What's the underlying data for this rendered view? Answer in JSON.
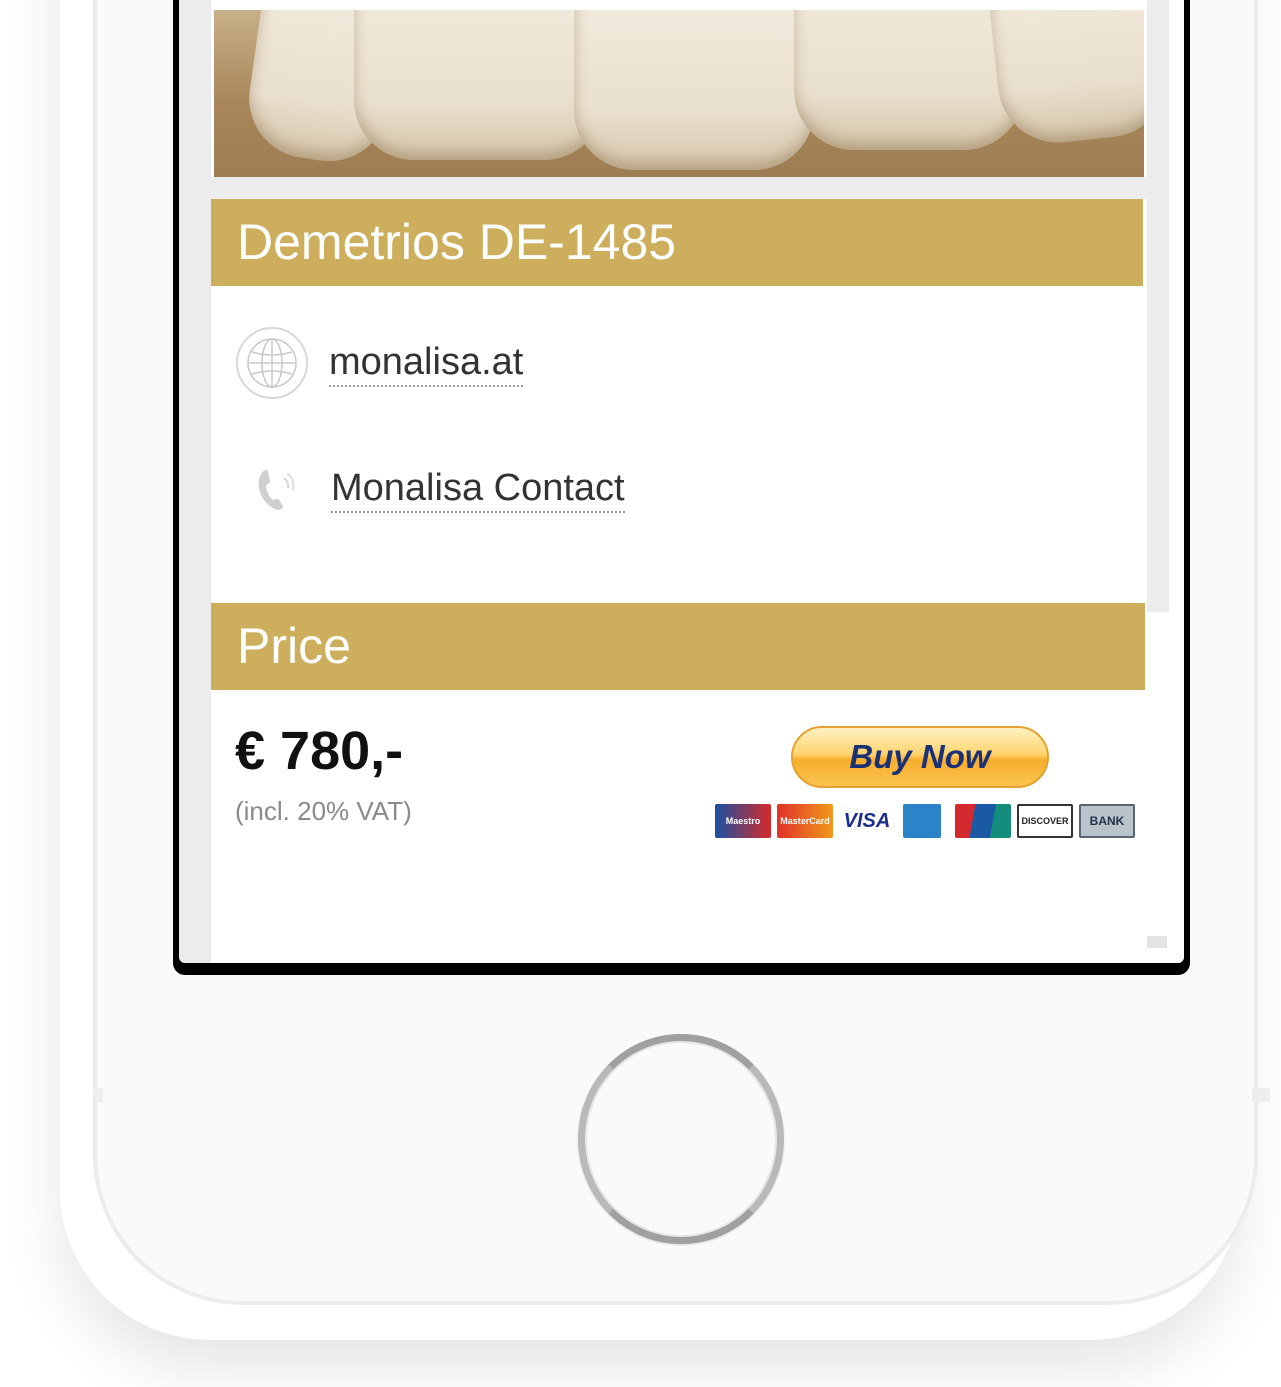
{
  "product": {
    "title": "Demetrios DE-1485"
  },
  "links": {
    "website_label": "monalisa.at",
    "contact_label": "Monalisa Contact"
  },
  "price_section": {
    "heading": "Price",
    "amount": "€ 780,-",
    "vat_note": "(incl. 20% VAT)",
    "buy_button_label": "Buy Now"
  },
  "payment_methods": [
    {
      "icon": "maestro-card-icon",
      "label": "Maestro"
    },
    {
      "icon": "mastercard-card-icon",
      "label": "MasterCard"
    },
    {
      "icon": "visa-card-icon",
      "label": "VISA"
    },
    {
      "icon": "amex-card-icon",
      "label": ""
    },
    {
      "icon": "unionpay-card-icon",
      "label": ""
    },
    {
      "icon": "discover-card-icon",
      "label": "DISCOVER"
    },
    {
      "icon": "bank-card-icon",
      "label": "BANK"
    }
  ],
  "icons": {
    "website": "globe-icon",
    "contact": "phone-icon"
  },
  "colors": {
    "header_gold": "#cdae5c",
    "buy_button_text": "#1a3174",
    "buy_button_orange": "#f8ad2d"
  }
}
